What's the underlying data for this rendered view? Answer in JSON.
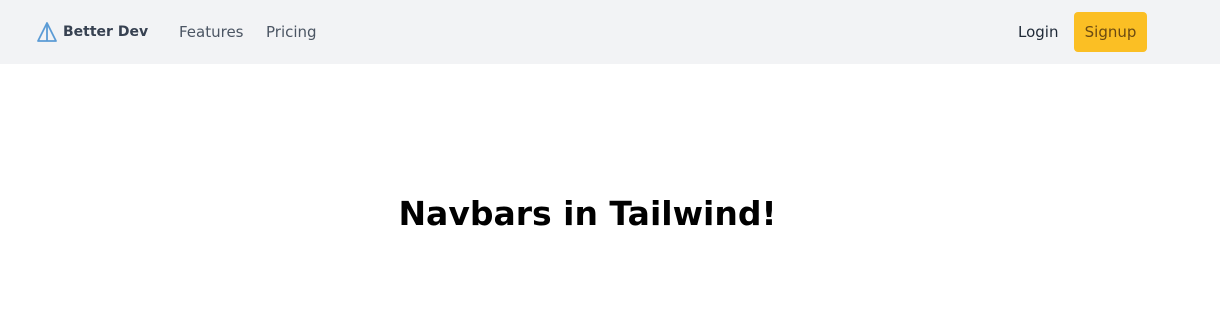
{
  "navbar": {
    "brand": {
      "name": "Better Dev",
      "logo_icon": "triangle-logo-icon",
      "logo_color": "#5b9bd5"
    },
    "links": [
      {
        "label": "Features"
      },
      {
        "label": "Pricing"
      }
    ],
    "login_label": "Login",
    "signup_label": "Signup",
    "background_color": "#f2f3f5",
    "signup_color": "#fbbf24"
  },
  "main": {
    "heading": "Navbars in Tailwind!"
  }
}
